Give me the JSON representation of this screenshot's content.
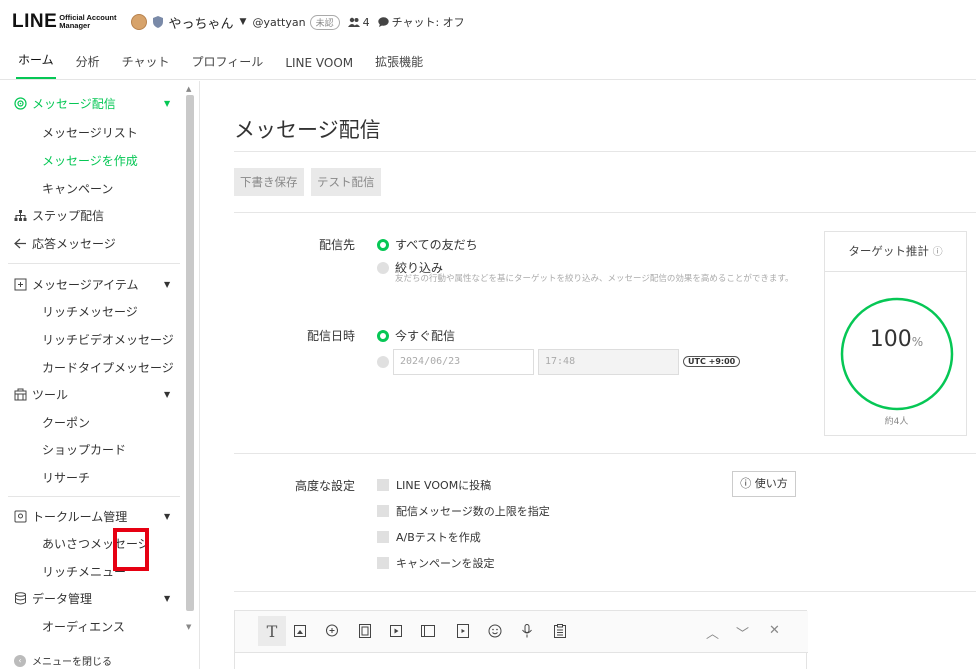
{
  "topbar": {
    "logo_main": "LINE",
    "logo_sub1": "Official Account",
    "logo_sub2": "Manager",
    "account_name": "やっちゃん",
    "account_id": "@yattyan",
    "badge": "未認",
    "friends_count": "4",
    "chat_status": "チャット: オフ"
  },
  "tabs": [
    {
      "label": "ホーム"
    },
    {
      "label": "分析"
    },
    {
      "label": "チャット"
    },
    {
      "label": "プロフィール"
    },
    {
      "label": "LINE VOOM"
    },
    {
      "label": "拡張機能"
    }
  ],
  "sidebar": {
    "message_delivery": "メッセージ配信",
    "message_list": "メッセージリスト",
    "create_message": "メッセージを作成",
    "campaign": "キャンペーン",
    "step_delivery": "ステップ配信",
    "auto_reply": "応答メッセージ",
    "message_items": "メッセージアイテム",
    "rich_message": "リッチメッセージ",
    "rich_video": "リッチビデオメッセージ",
    "card_type": "カードタイプメッセージ",
    "tools": "ツール",
    "coupon": "クーポン",
    "shop_card": "ショップカード",
    "research": "リサーチ",
    "talkroom": "トークルーム管理",
    "greeting": "あいさつメッセージ",
    "rich_menu": "リッチメニュー",
    "data_mgmt": "データ管理",
    "audience": "オーディエンス",
    "close_menu": "メニューを閉じる"
  },
  "main": {
    "title": "メッセージ配信",
    "save_draft": "下書き保存",
    "test_send": "テスト配信",
    "recipients_label": "配信先",
    "all_friends": "すべての友だち",
    "filter": "絞り込み",
    "filter_hint": "友だちの行動や属性などを基にターゲットを絞り込み、メッセージ配信の効果を高めることができます。",
    "datetime_label": "配信日時",
    "send_now": "今すぐ配信",
    "date_value": "2024/06/23",
    "time_value": "17:48",
    "utc": "UTC +9:00",
    "advanced_label": "高度な設定",
    "voom_post": "LINE VOOMに投稿",
    "limit_count": "配信メッセージ数の上限を指定",
    "ab_test": "A/Bテストを作成",
    "set_campaign": "キャンペーンを設定",
    "how_to": "使い方"
  },
  "target": {
    "heading": "ターゲット推計",
    "percent_value": "100",
    "percent_unit": "%",
    "people": "約4人",
    "ring_color": "#06c755"
  },
  "colors": {
    "accent": "#06c755",
    "highlight": "#e60012"
  }
}
